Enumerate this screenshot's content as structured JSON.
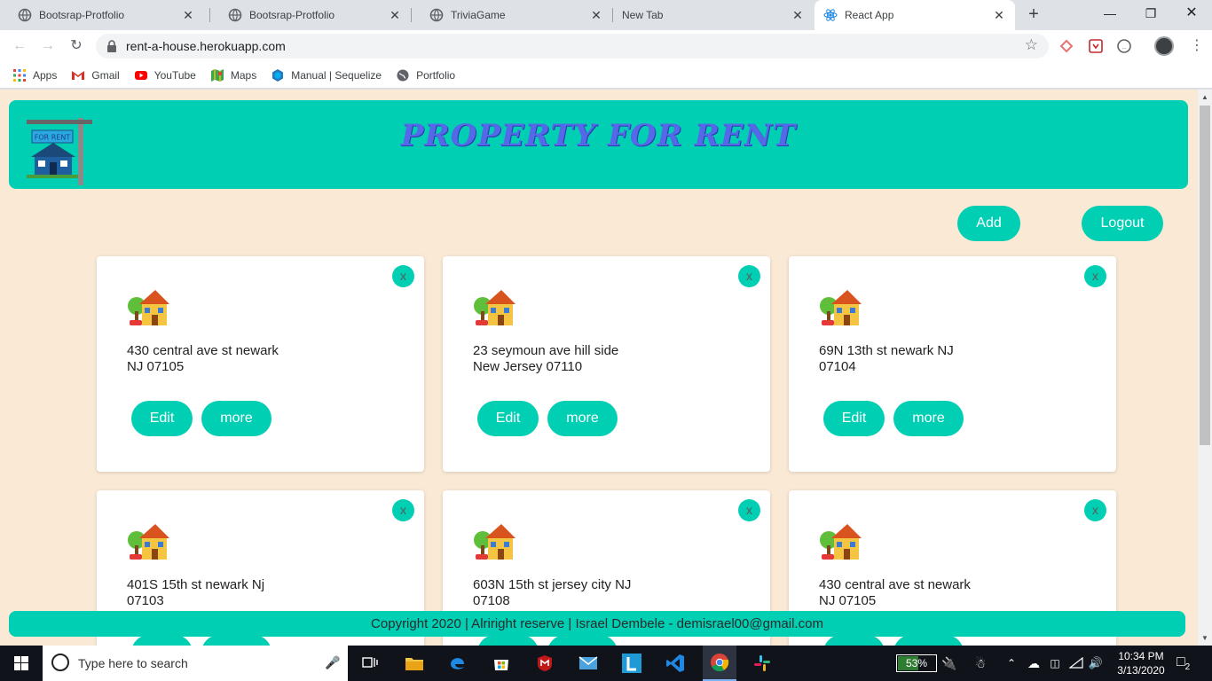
{
  "browser": {
    "tabs": [
      {
        "title": "Bootsrap-Protfolio",
        "icon": "globe-icon",
        "active": false
      },
      {
        "title": "Bootsrap-Protfolio",
        "icon": "globe-icon",
        "active": false
      },
      {
        "title": "TriviaGame",
        "icon": "globe-icon",
        "active": false
      },
      {
        "title": "New Tab",
        "icon": "",
        "active": false
      },
      {
        "title": "React App",
        "icon": "react-icon",
        "active": true
      }
    ],
    "close_glyph": "✕",
    "new_tab_glyph": "+",
    "url": "rent-a-house.herokuapp.com",
    "bookmarks": [
      {
        "label": "Apps",
        "icon": "apps-grid-icon"
      },
      {
        "label": "Gmail",
        "icon": "gmail-icon"
      },
      {
        "label": "YouTube",
        "icon": "youtube-icon"
      },
      {
        "label": "Maps",
        "icon": "maps-icon"
      },
      {
        "label": "Manual | Sequelize",
        "icon": "sequelize-icon"
      },
      {
        "label": "Portfolio",
        "icon": "globe-icon"
      }
    ]
  },
  "page": {
    "title": "PROPERTY FOR RENT",
    "logo_sign": "FOR RENT",
    "add_label": "Add",
    "logout_label": "Logout",
    "delete_glyph": "x",
    "edit_label": "Edit",
    "more_label": "more",
    "properties": [
      {
        "line1": "430 central ave st newark",
        "line2": "NJ 07105"
      },
      {
        "line1": "23 seymoun ave hill side",
        "line2": "New Jersey 07110"
      },
      {
        "line1": "69N 13th st newark NJ",
        "line2": "07104"
      },
      {
        "line1": "401S 15th st newark Nj",
        "line2": "07103"
      },
      {
        "line1": "603N 15th st jersey city NJ",
        "line2": "07108"
      },
      {
        "line1": "430 central ave st newark",
        "line2": "NJ 07105"
      }
    ],
    "footer": "Copyright 2020 | Alriright reserve | Israel Dembele - demisrael00@gmail.com"
  },
  "taskbar": {
    "search_placeholder": "Type here to search",
    "battery": "53%",
    "battery_level": 0.53,
    "time": "10:34 PM",
    "date": "3/13/2020",
    "notifications": "2"
  },
  "colors": {
    "accent": "#00cfb4",
    "page_bg": "#fae9d5",
    "title": "#5468e8"
  }
}
